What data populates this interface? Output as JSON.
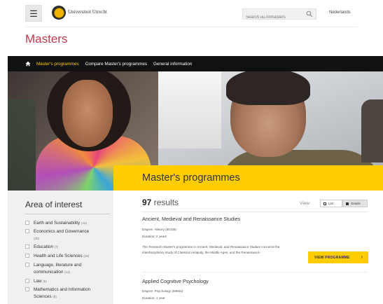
{
  "header": {
    "menu_icon": "hamburger-icon",
    "university_name": "Universiteit Utrecht",
    "search_placeholder": "Search uu.nl/masters",
    "search_icon": "search-icon",
    "language": "Nederlands"
  },
  "page_title": "Masters",
  "nav": {
    "home_icon": "home-icon",
    "items": [
      {
        "label": "Master's programmes",
        "active": true
      },
      {
        "label": "Compare Master's programmes",
        "active": false
      },
      {
        "label": "General information",
        "active": false
      }
    ]
  },
  "hero": {
    "banner_title": "Master's programmes"
  },
  "sidebar": {
    "title": "Area of interest",
    "facets": [
      {
        "label": "Earth and Sustainability",
        "count": "(44)"
      },
      {
        "label": "Economics and Governance",
        "count": "(30)"
      },
      {
        "label": "Education",
        "count": "(7)"
      },
      {
        "label": "Health and Life Sciences",
        "count": "(28)"
      },
      {
        "label": "Language, literature and communication",
        "count": "(14)"
      },
      {
        "label": "Law",
        "count": "(6)"
      },
      {
        "label": "Mathematics and Information Sciences",
        "count": "(8)"
      }
    ]
  },
  "results": {
    "count": "97",
    "count_suffix": "results",
    "view_label": "View:",
    "view_list": "List",
    "view_details": "Details",
    "programmes": [
      {
        "title": "Ancient, Medieval and Renaissance Studies",
        "degree": "Degree: History (60139)",
        "duration": "Duration: 2 years",
        "description": "The Research Master's programme in Ancient, Medieval, and Renaissance Studies concerns the interdisciplinary study of Classical Antiquity, the Middle Ages, and the Renaissance.",
        "button": "VIEW PROGRAMME"
      },
      {
        "title": "Applied Cognitive Psychology",
        "degree": "Degree: Psychology (66604)",
        "duration": "Duration: 1 year"
      }
    ]
  },
  "colors": {
    "accent_red": "#c0394d",
    "accent_yellow": "#ffcd00",
    "nav_bg": "#111111"
  }
}
